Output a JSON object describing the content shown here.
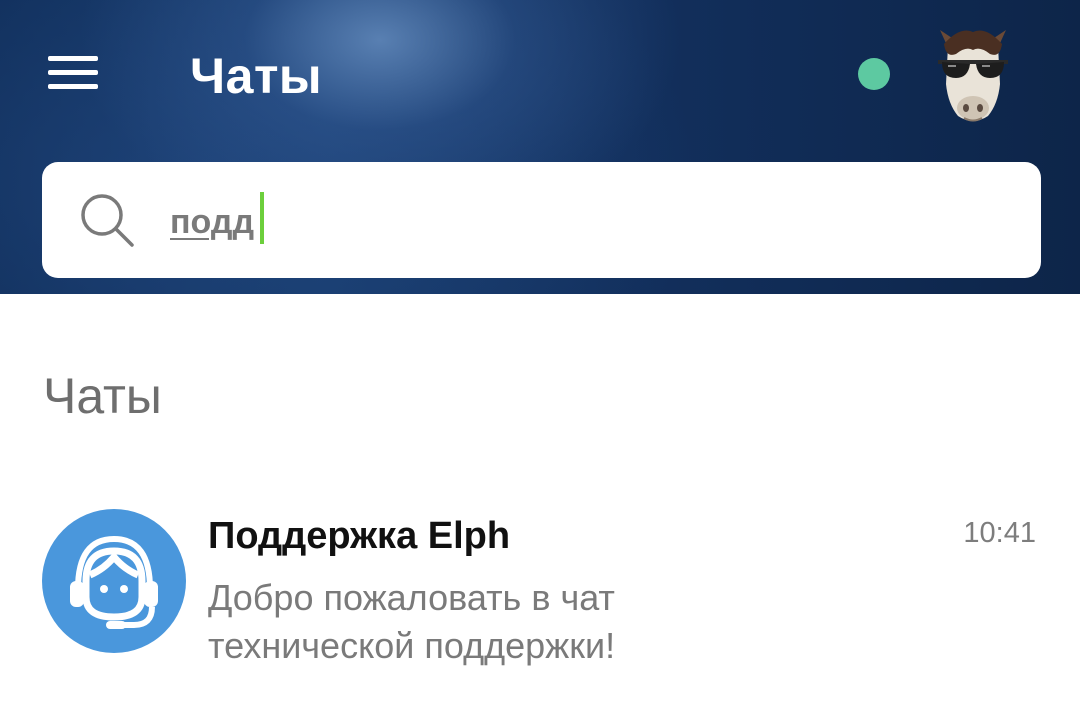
{
  "header": {
    "title": "Чаты",
    "status_color": "#5dc9a1",
    "menu_icon": "hamburger-menu-icon",
    "avatar_icon": "horse-sunglasses-avatar"
  },
  "search": {
    "value": "подд",
    "icon": "search-icon",
    "caret_color": "#6ccf3c"
  },
  "section": {
    "title": "Чаты"
  },
  "chats": [
    {
      "name": "Поддержка Elph",
      "time": "10:41",
      "preview": "Добро пожаловать в чат технической поддержки!",
      "avatar_icon": "support-headset-icon",
      "avatar_color": "#4a97dc"
    }
  ]
}
